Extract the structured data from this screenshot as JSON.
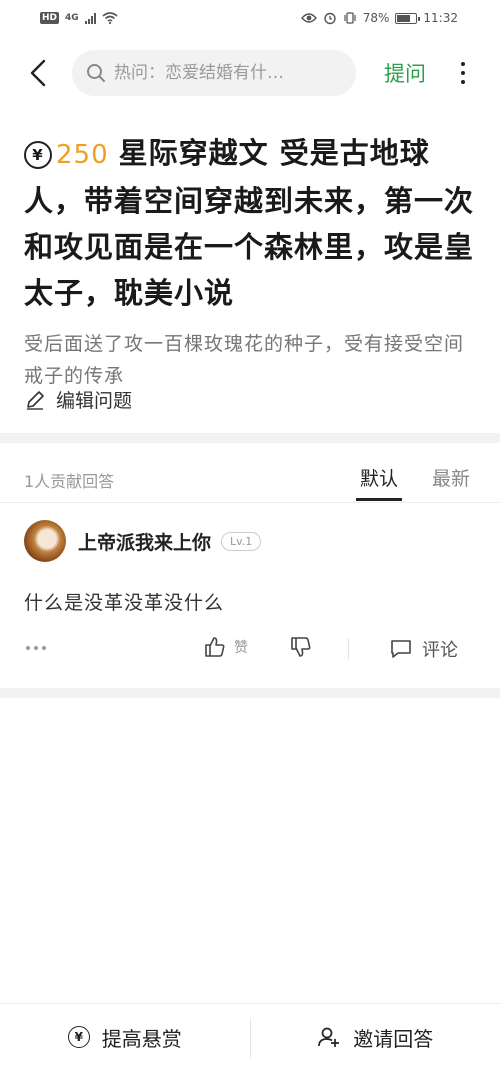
{
  "status_bar": {
    "hd": "HD",
    "network": "4G",
    "battery_text": "78%",
    "battery_level": 0.78,
    "time": "11:32"
  },
  "nav": {
    "search_placeholder": "热问：恋爱结婚有什…",
    "ask_label": "提问",
    "accent_color": "#2c9f4b"
  },
  "question": {
    "bounty_symbol": "¥",
    "bounty_amount": "250",
    "title": "星际穿越文 受是古地球人，带着空间穿越到未来，第一次和攻见面是在一个森林里，攻是皇太子，耽美小说",
    "description": "受后面送了攻一百棵玫瑰花的种子，受有接受空间戒子的传承",
    "edit_label": "编辑问题"
  },
  "answers_header": {
    "count_text": "1人贡献回答",
    "sort_default": "默认",
    "sort_latest": "最新"
  },
  "answer": {
    "author": "上帝派我来上你",
    "level": "Lv.1",
    "text": "什么是没革没革没什么",
    "like_label": "赞",
    "comment_label": "评论"
  },
  "bottom_bar": {
    "raise_bounty_label": "提高悬赏",
    "invite_label": "邀请回答"
  },
  "icons": [
    "back-arrow-icon",
    "search-icon",
    "more-vertical-icon",
    "yen-icon",
    "edit-pencil-icon",
    "thumbs-up-icon",
    "thumbs-down-icon",
    "comment-icon",
    "ellipsis-icon",
    "add-user-icon"
  ]
}
